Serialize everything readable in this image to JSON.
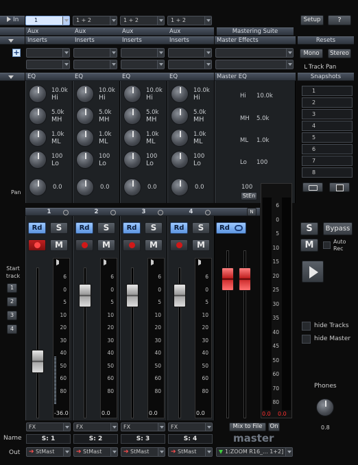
{
  "top": {
    "in_label": "In",
    "ch1_sel": "1",
    "ch_sel": "1 + 2",
    "setup": "Setup",
    "help": "?"
  },
  "rows": {
    "aux": "Aux",
    "inserts": "Inserts",
    "eq": "EQ",
    "mastering_suite": "Mastering Suite",
    "master_effects": "Master Effects",
    "master_eq": "Master EQ",
    "resets": "Resets",
    "snapshots": "Snapshots",
    "mono": "Mono",
    "stereo": "Stereo",
    "trackpan": "Track Pan"
  },
  "eq": {
    "hi": "Hi",
    "mh": "MH",
    "ml": "ML",
    "lo": "Lo",
    "f_hi": "10.0k",
    "f_mh": "5.0k",
    "f_ml": "1.0k",
    "f_lo": "100",
    "pan_val": "0.0"
  },
  "master_eq": {
    "hi": "Hi",
    "mh": "MH",
    "ml": "ML",
    "lo": "Lo",
    "f_hi": "10.0k",
    "f_mh": "5.0k",
    "f_ml": "1.0k",
    "f_lo": "100",
    "width_val": "100",
    "sten": "StEn"
  },
  "labels": {
    "pan": "Pan",
    "start_track": "Start track",
    "name": "Name",
    "out": "Out",
    "master": "master",
    "mix_to_file": "Mix to File",
    "on": "On",
    "phones": "Phones",
    "phones_val": "0.8",
    "bypass": "Bypass",
    "auto_rec": "Auto Rec",
    "hide_tracks": "hide Tracks",
    "hide_master": "hide Master",
    "N": "N"
  },
  "start_tracks": [
    "1",
    "2",
    "3",
    "4"
  ],
  "snapshots": [
    "1",
    "2",
    "3",
    "4",
    "5",
    "6",
    "7",
    "8"
  ],
  "channels": [
    {
      "num": "1",
      "name": "S: 1",
      "out": "StMast",
      "fx": "FX",
      "level": "-36.0",
      "rec_active": true
    },
    {
      "num": "2",
      "name": "S: 2",
      "out": "StMast",
      "fx": "FX",
      "level": "0.0",
      "rec_active": false
    },
    {
      "num": "3",
      "name": "S: 3",
      "out": "StMast",
      "fx": "FX",
      "level": "0.0",
      "rec_active": false
    },
    {
      "num": "4",
      "name": "S: 4",
      "out": "StMast",
      "fx": "FX",
      "level": "0.0",
      "rec_active": false
    }
  ],
  "master_ch": {
    "out": "1:ZOOM R16_... 1+2]",
    "level_l": "0.0",
    "level_r": "0.0"
  },
  "scale": [
    "6",
    "0",
    "5",
    "10",
    "20",
    "30",
    "40",
    "50",
    "60",
    "80"
  ],
  "master_scale": [
    "6",
    "0",
    "5",
    "10",
    "15",
    "20",
    "25",
    "30",
    "35",
    "40",
    "45",
    "50",
    "60",
    "70",
    "80"
  ],
  "buttons": {
    "rd": "Rd",
    "s": "S",
    "m": "M"
  }
}
